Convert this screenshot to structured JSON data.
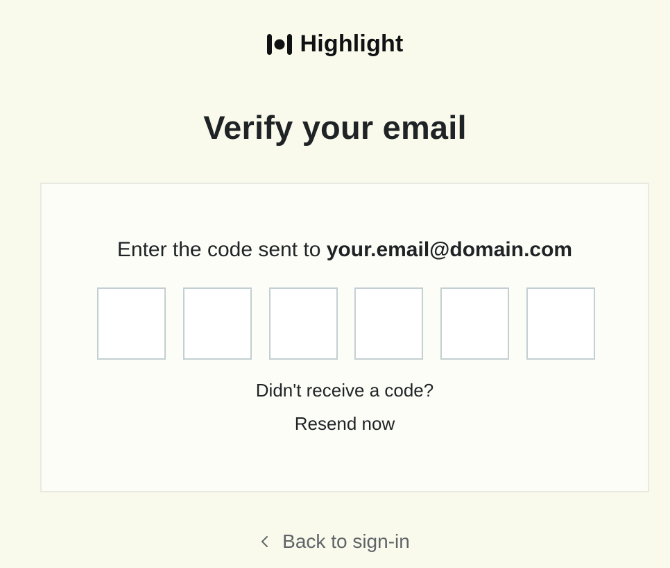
{
  "brand": {
    "name": "Highlight",
    "logo_icon": "highlight-logo-icon"
  },
  "page": {
    "title": "Verify your email"
  },
  "verify": {
    "instruction_prefix": "Enter the code sent to",
    "email": "your.email@domain.com",
    "code_length": 6,
    "code_values": [
      "",
      "",
      "",
      "",
      "",
      ""
    ],
    "no_code_text": "Didn't receive a code?",
    "resend_label": "Resend now"
  },
  "footer": {
    "back_label": "Back to sign-in",
    "back_icon": "chevron-left-icon"
  },
  "colors": {
    "background": "#f9faeb",
    "card": "#fdfdf7",
    "card_border": "#e8eae2",
    "input_border": "#c3cfd3",
    "text": "#1f2326",
    "muted": "#5f6468"
  }
}
